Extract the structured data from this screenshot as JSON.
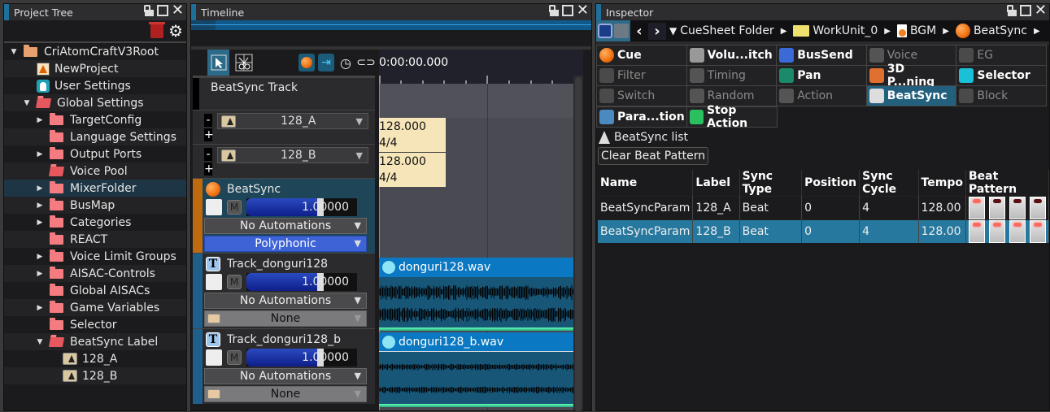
{
  "project_tree": {
    "title": "Project Tree",
    "items": [
      {
        "label": "CriAtomCraftV3Root",
        "icon": "folder-icon",
        "expand": "expanded",
        "indent": 0
      },
      {
        "label": "NewProject",
        "icon": "project-icon",
        "expand": "none",
        "indent": 1
      },
      {
        "label": "User Settings",
        "icon": "user-icon",
        "expand": "none",
        "indent": 1
      },
      {
        "label": "Global Settings",
        "icon": "folder-open-icon",
        "expand": "expanded",
        "indent": 1
      },
      {
        "label": "TargetConfig",
        "icon": "folder-icon",
        "expand": "collapsed",
        "indent": 2
      },
      {
        "label": "Language Settings",
        "icon": "folder-icon",
        "expand": "none",
        "indent": 2
      },
      {
        "label": "Output Ports",
        "icon": "folder-icon",
        "expand": "collapsed",
        "indent": 2
      },
      {
        "label": "Voice Pool",
        "icon": "folder-open-icon",
        "expand": "none",
        "indent": 2
      },
      {
        "label": "MixerFolder",
        "icon": "folder-icon",
        "expand": "collapsed",
        "indent": 2,
        "selected": true
      },
      {
        "label": "BusMap",
        "icon": "folder-icon",
        "expand": "collapsed",
        "indent": 2
      },
      {
        "label": "Categories",
        "icon": "folder-icon",
        "expand": "collapsed",
        "indent": 2
      },
      {
        "label": "REACT",
        "icon": "folder-icon",
        "expand": "none",
        "indent": 2
      },
      {
        "label": "Voice Limit Groups",
        "icon": "folder-icon",
        "expand": "collapsed",
        "indent": 2
      },
      {
        "label": "AISAC-Controls",
        "icon": "folder-icon",
        "expand": "collapsed",
        "indent": 2
      },
      {
        "label": "Global AISACs",
        "icon": "folder-icon",
        "expand": "none",
        "indent": 2
      },
      {
        "label": "Game Variables",
        "icon": "folder-icon",
        "expand": "collapsed",
        "indent": 2
      },
      {
        "label": "Selector",
        "icon": "folder-icon",
        "expand": "none",
        "indent": 2
      },
      {
        "label": "BeatSync Label",
        "icon": "folder-open-icon",
        "expand": "expanded",
        "indent": 2
      },
      {
        "label": "128_A",
        "icon": "beatsync-label-icon",
        "expand": "none",
        "indent": 3
      },
      {
        "label": "128_B",
        "icon": "beatsync-label-icon",
        "expand": "none",
        "indent": 3
      }
    ]
  },
  "timeline": {
    "title": "Timeline",
    "time": "0:00:00.000",
    "beatsync_track": {
      "header": "BeatSync Track",
      "labels": [
        {
          "label": "128_A",
          "tempo": "128.000",
          "meter": "4/4"
        },
        {
          "label": "128_B",
          "tempo": "128.000",
          "meter": "4/4"
        }
      ]
    },
    "tracks": [
      {
        "name": "BeatSync",
        "type": "cue",
        "volume": "1.00000",
        "volume_level": 0.7,
        "automation": "No Automations",
        "mode": "Polyphonic"
      },
      {
        "name": "Track_donguri128",
        "type": "track",
        "volume": "1.00000",
        "volume_level": 0.7,
        "automation": "No Automations",
        "mode": "None",
        "waveform": "donguri128.wav"
      },
      {
        "name": "Track_donguri128_b",
        "type": "track",
        "volume": "1.00000",
        "volume_level": 0.7,
        "automation": "No Automations",
        "mode": "None",
        "waveform": "donguri128_b.wav"
      }
    ],
    "mute_label": "M"
  },
  "inspector": {
    "title": "Inspector",
    "breadcrumb": [
      "CueSheet Folder",
      "WorkUnit_0",
      "BGM",
      "BeatSync"
    ],
    "tabs": [
      {
        "label": "Cue",
        "enabled": true
      },
      {
        "label": "Volu...itch",
        "enabled": true
      },
      {
        "label": "BusSend",
        "enabled": true
      },
      {
        "label": "Voice",
        "enabled": false
      },
      {
        "label": "EG",
        "enabled": false
      },
      {
        "label": "Filter",
        "enabled": false
      },
      {
        "label": "Timing",
        "enabled": false
      },
      {
        "label": "Pan",
        "enabled": true
      },
      {
        "label": "3D P...ning",
        "enabled": true
      },
      {
        "label": "Selector",
        "enabled": true
      },
      {
        "label": "Switch",
        "enabled": false
      },
      {
        "label": "Random",
        "enabled": false
      },
      {
        "label": "Action",
        "enabled": false
      },
      {
        "label": "BeatSync",
        "enabled": true,
        "selected": true
      },
      {
        "label": "Block",
        "enabled": false
      },
      {
        "label": "Para...tion",
        "enabled": true
      },
      {
        "label": "Stop Action",
        "enabled": true
      }
    ],
    "section_title": "BeatSync list",
    "clear_button": "Clear Beat Pattern",
    "table": {
      "columns": [
        "Name",
        "Label",
        "Sync Type",
        "Position",
        "Sync Cycle",
        "Tempo",
        "Beat Pattern"
      ],
      "rows": [
        {
          "name": "BeatSyncParam",
          "label": "128_A",
          "sync_type": "Beat",
          "position": "0",
          "sync_cycle": "4",
          "tempo": "128.00",
          "beat_pattern": [
            true,
            false,
            false,
            false
          ]
        },
        {
          "name": "BeatSyncParam",
          "label": "128_B",
          "sync_type": "Beat",
          "position": "0",
          "sync_cycle": "4",
          "tempo": "128.00",
          "beat_pattern": [
            true,
            true,
            true,
            true
          ],
          "selected": true
        }
      ]
    }
  }
}
